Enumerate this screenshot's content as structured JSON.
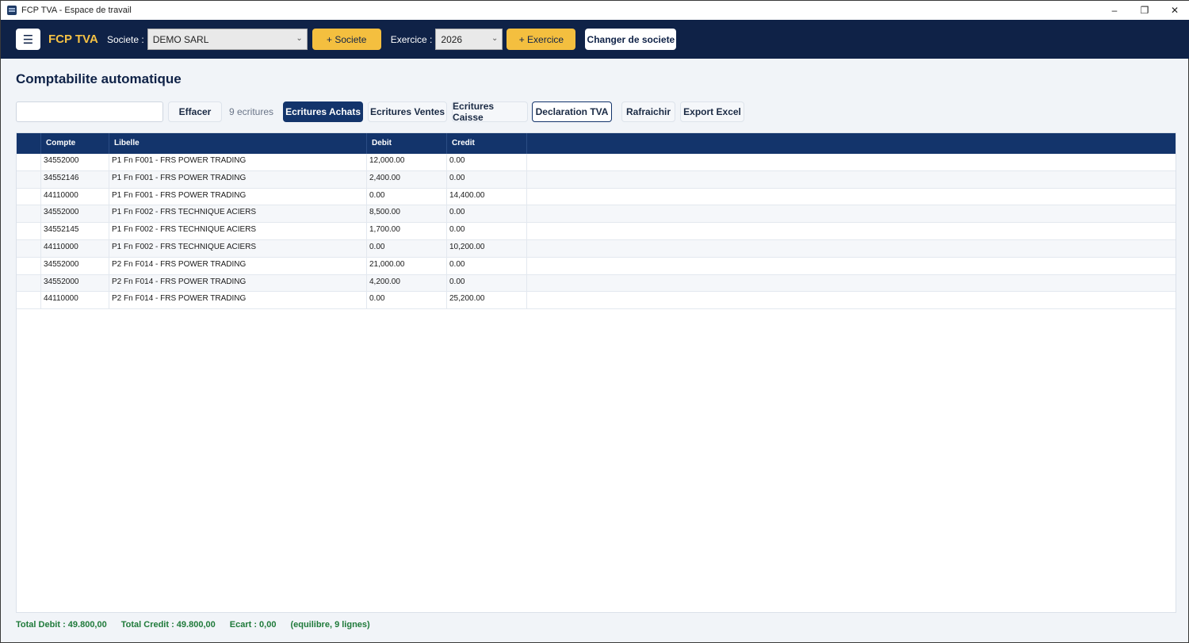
{
  "window": {
    "title": "FCP TVA - Espace de travail"
  },
  "topbar": {
    "menu_glyph": "☰",
    "brand": "FCP TVA",
    "societe_label": "Societe :",
    "societe_value": "DEMO SARL",
    "add_societe": "+ Societe",
    "exercice_label": "Exercice :",
    "exercice_value": "2026",
    "add_exercice": "+ Exercice",
    "change_societe": "Changer de societe"
  },
  "page": {
    "title": "Comptabilite automatique"
  },
  "toolbar": {
    "search_value": "",
    "clear": "Effacer",
    "count": "9 ecritures",
    "achats": "Ecritures Achats",
    "ventes": "Ecritures Ventes",
    "caisse": "Ecritures Caisse",
    "declaration": "Declaration TVA",
    "refresh": "Rafraichir",
    "export": "Export Excel"
  },
  "table": {
    "columns": [
      "Compte",
      "Libelle",
      "Debit",
      "Credit"
    ],
    "rows": [
      [
        "34552000",
        "P1 Fn F001 - FRS POWER TRADING",
        "12,000.00",
        "0.00"
      ],
      [
        "34552146",
        "P1 Fn F001 - FRS POWER TRADING",
        "2,400.00",
        "0.00"
      ],
      [
        "44110000",
        "P1 Fn F001 - FRS POWER TRADING",
        "0.00",
        "14,400.00"
      ],
      [
        "34552000",
        "P1 Fn F002 - FRS TECHNIQUE ACIERS",
        "8,500.00",
        "0.00"
      ],
      [
        "34552145",
        "P1 Fn F002 - FRS TECHNIQUE ACIERS",
        "1,700.00",
        "0.00"
      ],
      [
        "44110000",
        "P1 Fn F002 - FRS TECHNIQUE ACIERS",
        "0.00",
        "10,200.00"
      ],
      [
        "34552000",
        "P2 Fn F014 - FRS POWER TRADING",
        "21,000.00",
        "0.00"
      ],
      [
        "34552000",
        "P2 Fn F014 - FRS POWER TRADING",
        "4,200.00",
        "0.00"
      ],
      [
        "44110000",
        "P2 Fn F014 - FRS POWER TRADING",
        "0.00",
        "25,200.00"
      ]
    ]
  },
  "footer": {
    "total_debit": "Total Debit : 49.800,00",
    "total_credit": "Total Credit : 49.800,00",
    "ecart": "Ecart : 0,00",
    "status": "(equilibre, 9 lignes)"
  },
  "colors": {
    "nav": "#0f2247",
    "accent": "#f4bf3f",
    "header": "#13346b",
    "ok": "#1f7a3a"
  }
}
